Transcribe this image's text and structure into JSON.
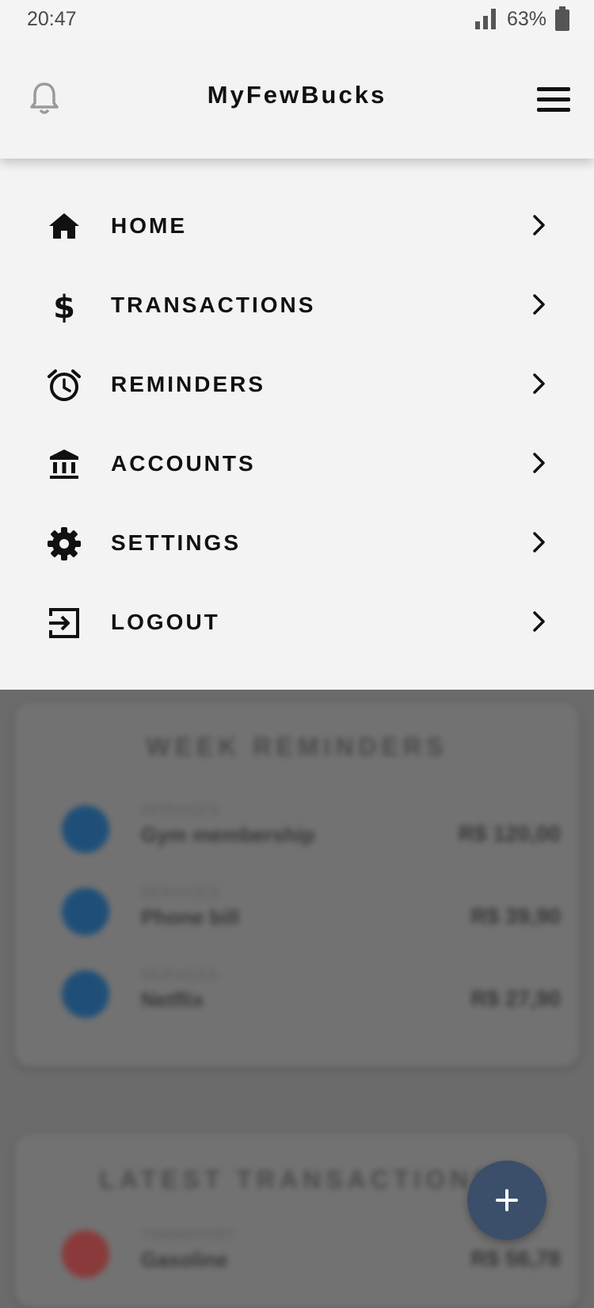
{
  "status_bar": {
    "time": "20:47",
    "battery": "63%"
  },
  "header": {
    "title": "MyFewBucks"
  },
  "menu": {
    "items": [
      {
        "label": "HOME",
        "icon": "home-icon"
      },
      {
        "label": "TRANSACTIONS",
        "icon": "dollar-icon"
      },
      {
        "label": "REMINDERS",
        "icon": "alarm-clock-icon"
      },
      {
        "label": "ACCOUNTS",
        "icon": "bank-icon"
      },
      {
        "label": "SETTINGS",
        "icon": "gear-icon"
      },
      {
        "label": "LOGOUT",
        "icon": "logout-icon"
      }
    ]
  },
  "week_reminders": {
    "title": "WEEK REMINDERS",
    "items": [
      {
        "category": "SERVICES",
        "name": "Gym membership",
        "amount": "R$ 120,00"
      },
      {
        "category": "SERVICES",
        "name": "Phone bill",
        "amount": "R$ 39,90"
      },
      {
        "category": "SERVICES",
        "name": "Netflix",
        "amount": "R$ 27,90"
      }
    ]
  },
  "latest_transactions": {
    "title": "LATEST TRANSACTIONS",
    "items": [
      {
        "category": "TRANSPORT",
        "name": "Gasoline",
        "amount": "R$ 56,78"
      }
    ]
  },
  "colors": {
    "fab": "#3b4f6a",
    "service_avatar": "#1f4f78",
    "transport_avatar": "#8a3a3a"
  }
}
